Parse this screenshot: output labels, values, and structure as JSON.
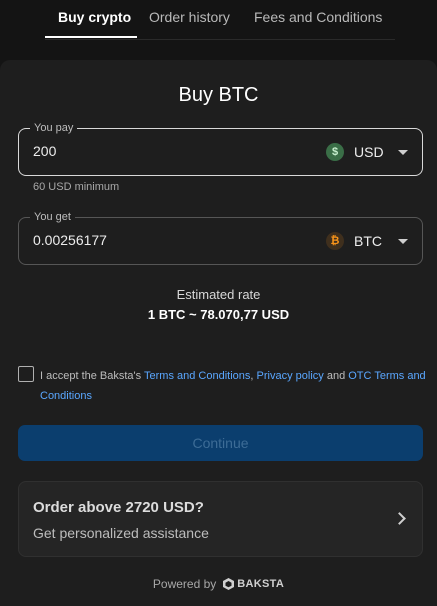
{
  "tabs": [
    {
      "label": "Buy crypto",
      "active": true
    },
    {
      "label": "Order history",
      "active": false
    },
    {
      "label": "Fees and Conditions",
      "active": false
    }
  ],
  "title": "Buy BTC",
  "pay": {
    "label": "You pay",
    "value": "200",
    "currency": "USD",
    "icon": "dollar-coin-icon",
    "hint": "60 USD minimum"
  },
  "get": {
    "label": "You get",
    "value": "0.00256177",
    "currency": "BTC",
    "icon": "bitcoin-coin-icon"
  },
  "rate": {
    "label": "Estimated rate",
    "value": "1 BTC ~ 78.070,77 USD"
  },
  "terms": {
    "prefix": "I accept the Baksta's ",
    "link1": "Terms and Conditions",
    "sep1": ", ",
    "link2": "Privacy policy",
    "sep2": " and ",
    "link3": "OTC Terms and Conditions",
    "checked": false
  },
  "continue_label": "Continue",
  "assist": {
    "title": "Order above 2720 USD?",
    "subtitle": "Get personalized assistance"
  },
  "footer": {
    "powered": "Powered by",
    "brand": "BAKSTA"
  },
  "colors": {
    "background": "#141414",
    "panel": "#1e1e1e",
    "link": "#5aa7ff",
    "button": "#0b3e6e"
  }
}
